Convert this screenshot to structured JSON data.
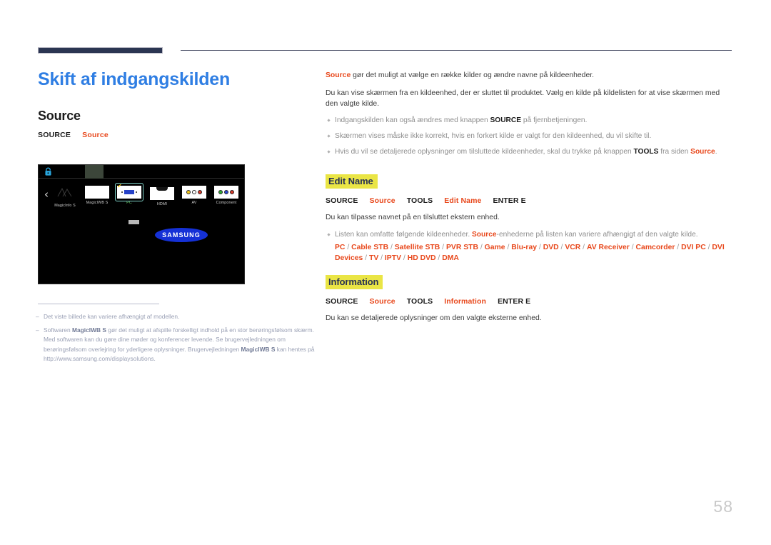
{
  "header": {
    "accent_bar_color": "#2b3552",
    "rule_color": "#4a4f66"
  },
  "left": {
    "page_title": "Skift af indgangskilden",
    "section_title": "Source",
    "menu_path": {
      "source_key": "SOURCE",
      "source_value": "Source"
    },
    "title_color": "#2f7ee3",
    "accent_color": "#e8481c"
  },
  "tv_screenshot": {
    "lock_icon": "lock-icon",
    "prev_arrow": "‹",
    "next_arrow": "›",
    "logo_text": "SAMSUNG",
    "sources": [
      {
        "label": "MagicInfo S",
        "icon": "magicinfo-icon",
        "selected": false
      },
      {
        "label": "MagicIWB S",
        "icon": "whiteboard-icon",
        "selected": false
      },
      {
        "label": "PC",
        "icon": "vga-port-icon",
        "selected": true
      },
      {
        "label": "HDMI",
        "icon": "hdmi-port-icon",
        "selected": false
      },
      {
        "label": "AV",
        "icon": "av-rca-icon",
        "selected": false
      },
      {
        "label": "Component",
        "icon": "component-rca-icon",
        "selected": false
      }
    ],
    "selected_check": "✔"
  },
  "footnotes": [
    {
      "dash": "–",
      "parts": [
        {
          "text": "Det viste billede kan variere afhængigt af modellen.",
          "bold": false
        }
      ]
    },
    {
      "dash": "–",
      "parts": [
        {
          "text": "Softwaren ",
          "bold": false
        },
        {
          "text": "MagicIWB S",
          "bold": true
        },
        {
          "text": " gør det muligt at afspille forskelligt indhold på en stor berøringsfølsom skærm. Med softwaren kan du gøre dine møder og konferencer levende. Se brugervejledningen om berøringsfølsom overlejring for yderligere oplysninger. Brugervejledningen ",
          "bold": false
        },
        {
          "text": "MagicIWB S",
          "bold": true
        },
        {
          "text": " kan hentes på http://www.samsung.com/displaysolutions.",
          "bold": false
        }
      ]
    }
  ],
  "right": {
    "intro_1_lead": "Source",
    "intro_1_rest": " gør det muligt at vælge en række kilder og ændre navne på kildeenheder.",
    "intro_2": "Du kan vise skærmen fra en kildeenhed, der er sluttet til produktet. Vælg en kilde på kildelisten for at vise skærmen med den valgte kilde.",
    "bullets": [
      {
        "pre": "Indgangskilden kan også ændres med knappen ",
        "bold": "SOURCE",
        "post": " på fjernbetjeningen."
      },
      {
        "pre": "Skærmen vises måske ikke korrekt, hvis en forkert kilde er valgt for den kildeenhed, du vil skifte til.",
        "bold": "",
        "post": ""
      },
      {
        "pre": "Hvis du vil se detaljerede oplysninger om tilsluttede kildeenheder, skal du trykke på knappen ",
        "bold": "TOOLS",
        "post": " fra siden ",
        "orange": "Source",
        "tail": "."
      }
    ],
    "sections": [
      {
        "heading": "Edit Name",
        "path": [
          {
            "text": "SOURCE",
            "style": "key"
          },
          {
            "text": "Source",
            "style": "value"
          },
          {
            "text": "TOOLS",
            "style": "key"
          },
          {
            "text": "Edit Name",
            "style": "value"
          },
          {
            "text": "ENTER E",
            "style": "key"
          }
        ],
        "description": "Du kan tilpasse navnet på en tilsluttet ekstern enhed.",
        "bullet": {
          "pre": "Listen kan omfatte følgende kildeenheder. ",
          "orange": "Source",
          "post": "-enhederne på listen kan variere afhængigt af den valgte kilde."
        },
        "device_list": [
          "PC",
          "Cable STB",
          "Satellite STB",
          "PVR STB",
          "Game",
          "Blu-ray",
          "DVD",
          "VCR",
          "AV Receiver",
          "Camcorder",
          "DVI PC",
          "DVI Devices",
          "TV",
          "IPTV",
          "HD DVD",
          "DMA"
        ]
      },
      {
        "heading": "Information",
        "path": [
          {
            "text": "SOURCE",
            "style": "key"
          },
          {
            "text": "Source",
            "style": "value"
          },
          {
            "text": "TOOLS",
            "style": "key"
          },
          {
            "text": "Information",
            "style": "value"
          },
          {
            "text": "ENTER E",
            "style": "key"
          }
        ],
        "description": "Du kan se detaljerede oplysninger om den valgte eksterne enhed.",
        "bullet": null,
        "device_list": []
      }
    ],
    "highlight_color": "#eae545"
  },
  "page_number": "58"
}
